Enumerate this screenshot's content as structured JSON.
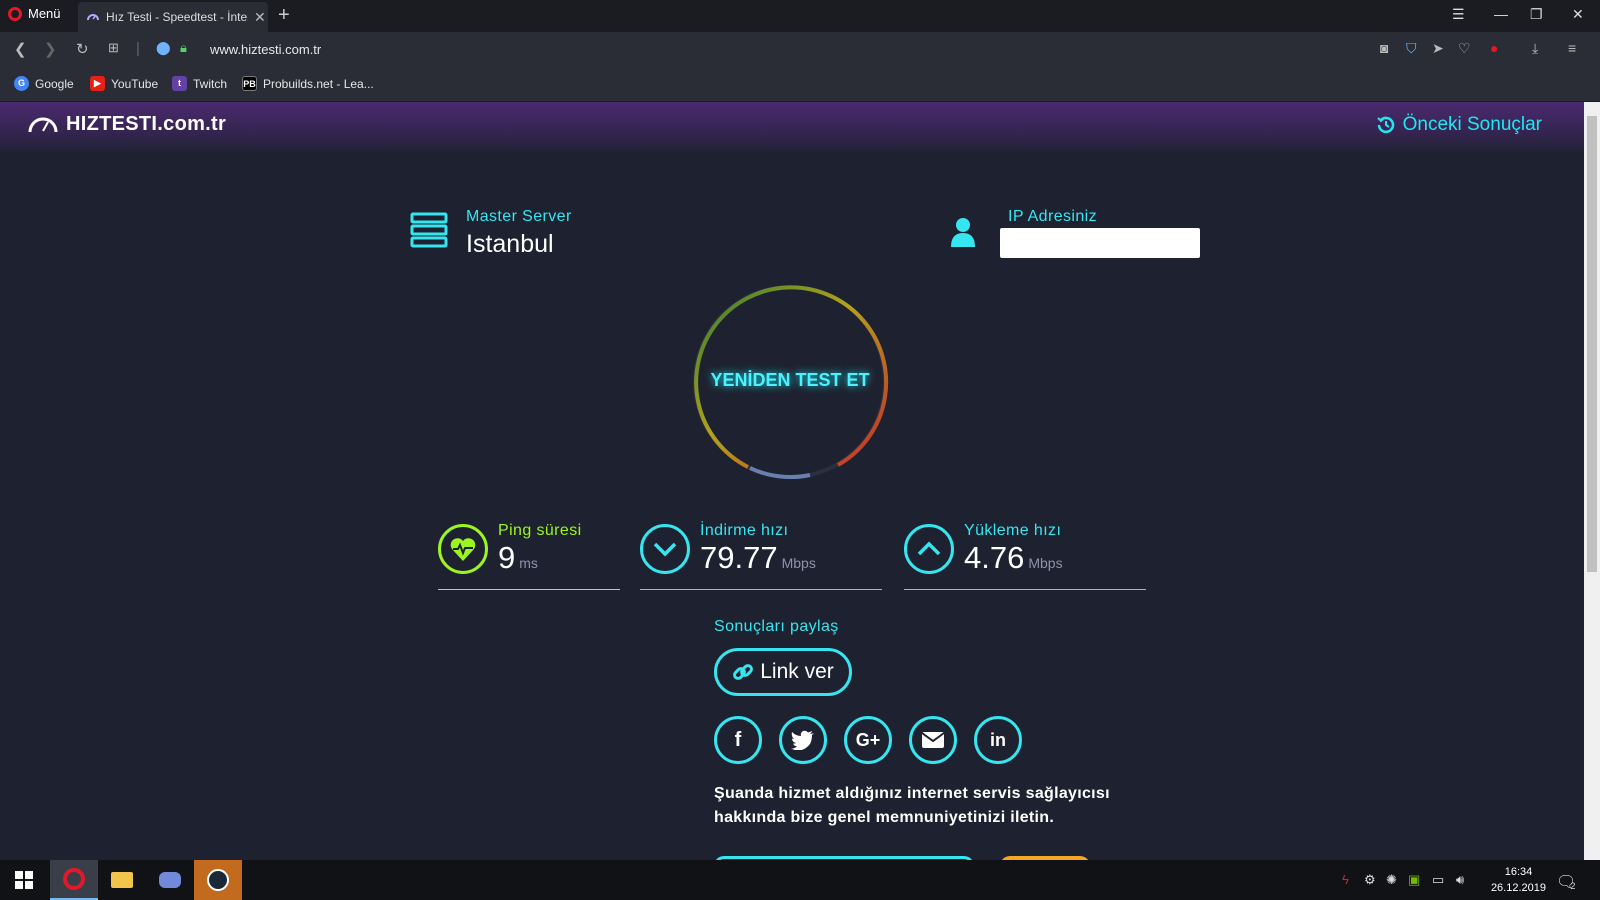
{
  "browser": {
    "menu_label": "Menü",
    "tab_title": "Hız Testi - Speedtest - İnternet",
    "new_tab": "+",
    "url": "www.hiztesti.com.tr",
    "bookmarks": [
      {
        "label": "Google",
        "icon": "google-icon",
        "color": "#4285f4"
      },
      {
        "label": "YouTube",
        "icon": "youtube-icon",
        "color": "#e62117"
      },
      {
        "label": "Twitch",
        "icon": "twitch-icon",
        "color": "#6441a5"
      },
      {
        "label": "Probuilds.net - Lea...",
        "icon": "probuilds-icon",
        "color": "#222222"
      }
    ]
  },
  "site": {
    "logo_text": "HIZTESTI.com.tr",
    "prev_results": "Önceki Sonuçlar",
    "server_label": "Master Server",
    "server_value": "Istanbul",
    "ip_label": "IP Adresiniz",
    "retest": "YENİDEN TEST ET",
    "ping": {
      "label": "Ping süresi",
      "value": "9",
      "unit": "ms"
    },
    "download": {
      "label": "İndirme hızı",
      "value": "79.77",
      "unit": "Mbps"
    },
    "upload": {
      "label": "Yükleme hızı",
      "value": "4.76",
      "unit": "Mbps"
    },
    "share_label": "Sonuçları paylaş",
    "link_button": "Link ver",
    "social": [
      "facebook",
      "twitter",
      "google-plus",
      "email",
      "linkedin"
    ],
    "feedback_line1": "Şuanda hizmet aldığınız internet servis sağlayıcısı",
    "feedback_line2": "hakkında bize genel memnuniyetinizi iletin.",
    "accent": "#35e6f0",
    "ping_color": "#9cf51f"
  },
  "taskbar": {
    "time": "16:34",
    "date": "26.12.2019",
    "notifications": "2"
  }
}
